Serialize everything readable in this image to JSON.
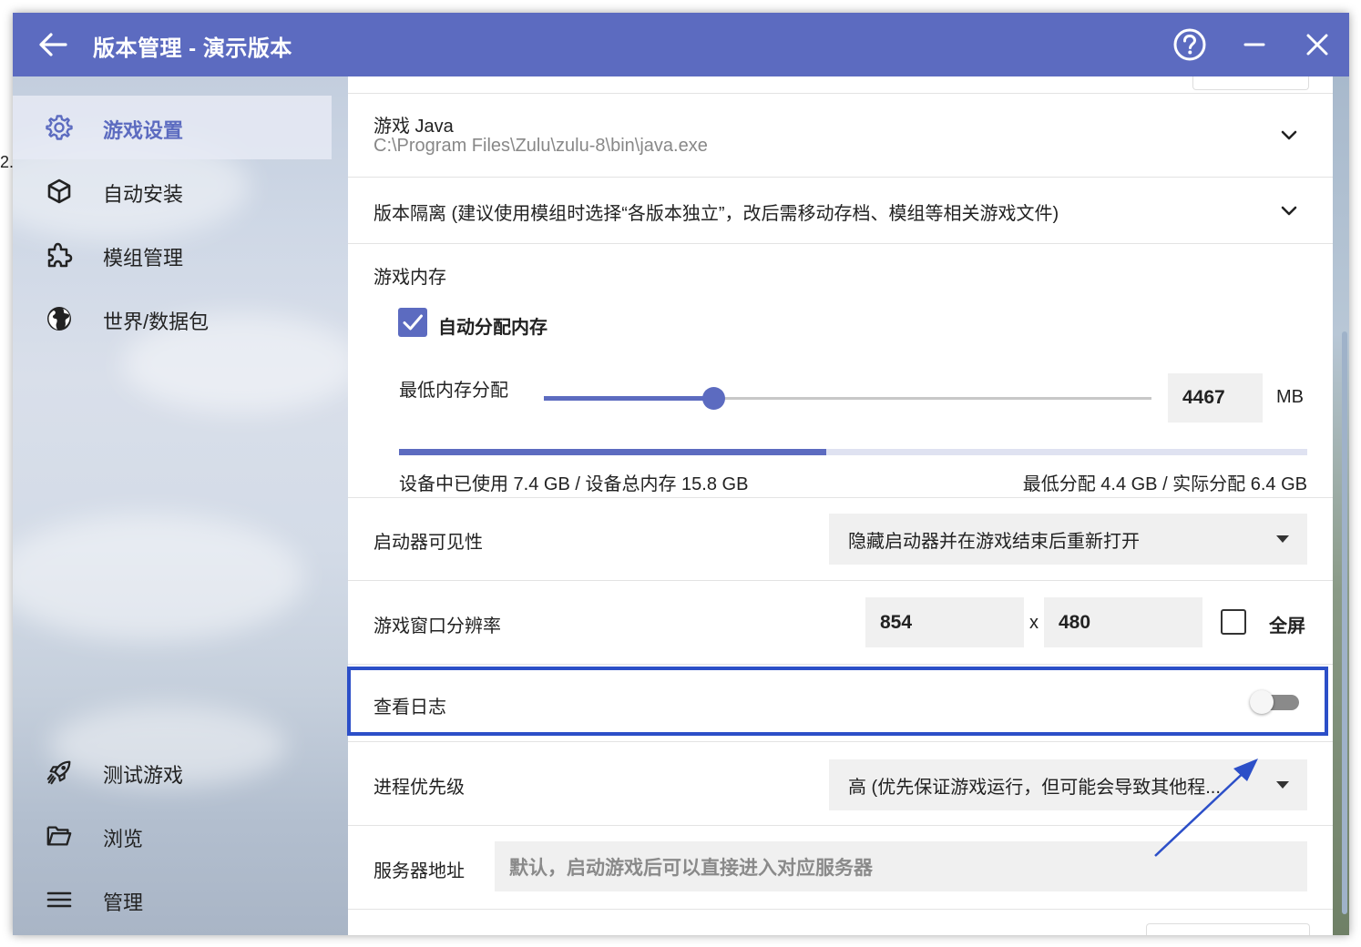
{
  "window": {
    "title": "版本管理 - 演示版本"
  },
  "sidebar": {
    "items": [
      {
        "label": "游戏设置",
        "icon": "gear-icon",
        "active": true
      },
      {
        "label": "自动安装",
        "icon": "cube-icon"
      },
      {
        "label": "模组管理",
        "icon": "puzzle-icon"
      },
      {
        "label": "世界/数据包",
        "icon": "globe-icon"
      },
      {
        "label": "测试游戏",
        "icon": "rocket-icon"
      },
      {
        "label": "浏览",
        "icon": "folder-icon"
      },
      {
        "label": "管理",
        "icon": "menu-icon"
      }
    ]
  },
  "settings": {
    "java": {
      "label": "游戏 Java",
      "path": "C:\\Program Files\\Zulu\\zulu-8\\bin\\java.exe"
    },
    "isolation": {
      "label": "版本隔离 (建议使用模组时选择“各版本独立”，改后需移动存档、模组等相关游戏文件)"
    },
    "memory": {
      "label": "游戏内存",
      "auto_label": "自动分配内存",
      "auto_checked": true,
      "min_label": "最低内存分配",
      "min_value": "4467",
      "unit": "MB",
      "slider_fraction": 0.28,
      "used_fraction": 0.47,
      "usage_text": "设备中已使用 7.4 GB / 设备总内存 15.8 GB",
      "alloc_text": "最低分配 4.4 GB / 实际分配 6.4 GB"
    },
    "visibility": {
      "label": "启动器可见性",
      "value": "隐藏启动器并在游戏结束后重新打开"
    },
    "resolution": {
      "label": "游戏窗口分辨率",
      "width": "854",
      "separator": "x",
      "height": "480",
      "fullscreen_label": "全屏",
      "fullscreen_checked": false
    },
    "logs": {
      "label": "查看日志",
      "enabled": false
    },
    "priority": {
      "label": "进程优先级",
      "value": "高 (优先保证游戏运行，但可能会导致其他程..."
    },
    "server": {
      "label": "服务器地址",
      "placeholder": "默认，启动游戏后可以直接进入对应服务器"
    }
  },
  "stray": "2.",
  "colors": {
    "accent": "#5c6bc0",
    "highlight": "#2c4fc8"
  }
}
